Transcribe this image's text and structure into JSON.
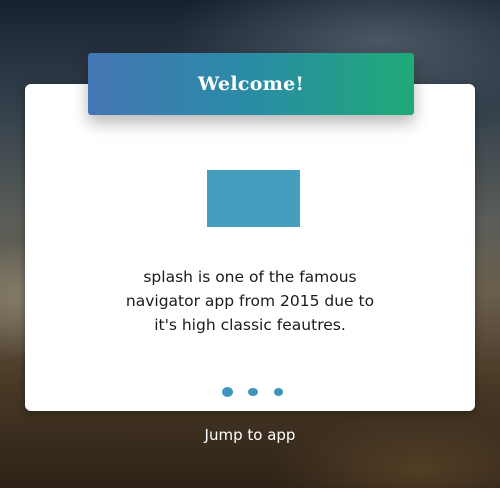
{
  "header": {
    "title": "Welcome!"
  },
  "card": {
    "logo_icon": "app-logo-icon",
    "description_lines": [
      "splash is one of the famous",
      "navigator app from 2015 due to",
      "it's high classic feautres."
    ]
  },
  "pagination": {
    "page_count": 3,
    "active_page": 1
  },
  "footer": {
    "jump_label": "Jump to app"
  },
  "colors": {
    "accent": "#469ebe",
    "header_gradient_start": "#4376b4",
    "header_gradient_end": "#1faa76",
    "dot_color": "#3f94bc"
  }
}
